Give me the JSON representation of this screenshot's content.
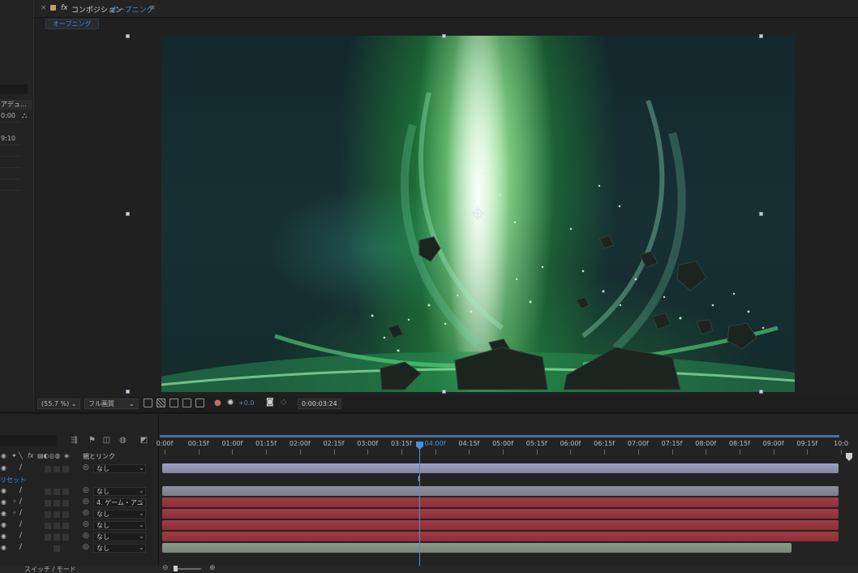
{
  "comp_header": {
    "close_glyph": "×",
    "lock_icon": "lock-icon",
    "fx_glyph": "fx",
    "title_prefix": "コンポジション",
    "comp_name": "オープニング",
    "menu_glyph": "≡",
    "subtab": "オープニング"
  },
  "left_panel": {
    "col_header": "アデュ...",
    "rows": [
      "0:00",
      "9:10"
    ]
  },
  "viewer_toolbar": {
    "zoom": "(55.7 %)",
    "zoom_chevron": "⌄",
    "resolution": "フル画質",
    "res_chevron": "⌄",
    "exposure": "+0.0",
    "timecode": "0:00:03:24"
  },
  "timeline": {
    "ruler_labels": [
      "0:00f",
      "00:15f",
      "01:00f",
      "01:15f",
      "02:00f",
      "02:15f",
      "03:00f",
      "03:15f",
      "04:00f",
      "04:15f",
      "05:00f",
      "05:15f",
      "06:00f",
      "06:15f",
      "07:00f",
      "07:15f",
      "08:00f",
      "08:15f",
      "09:00f",
      "09:15f",
      "10:0"
    ],
    "column_header": "親とリンク",
    "preset_label": "リセット",
    "layers": [
      {
        "parent": "なし",
        "bar": "purple"
      },
      {
        "parent": "なし",
        "bar": "gray"
      },
      {
        "parent": "4. ゲーム・アニ",
        "bar": "red"
      },
      {
        "parent": "なし",
        "bar": "red"
      },
      {
        "parent": "なし",
        "bar": "red"
      },
      {
        "parent": "なし",
        "bar": "red"
      },
      {
        "parent": "なし",
        "bar": "sage"
      }
    ],
    "bottom_label": "スイッチ / モード",
    "playhead_time": "04:00f"
  },
  "colors": {
    "accent_blue": "#4b8fd8",
    "bar_purple": "#9ea1c2",
    "bar_red": "#a23c45"
  }
}
